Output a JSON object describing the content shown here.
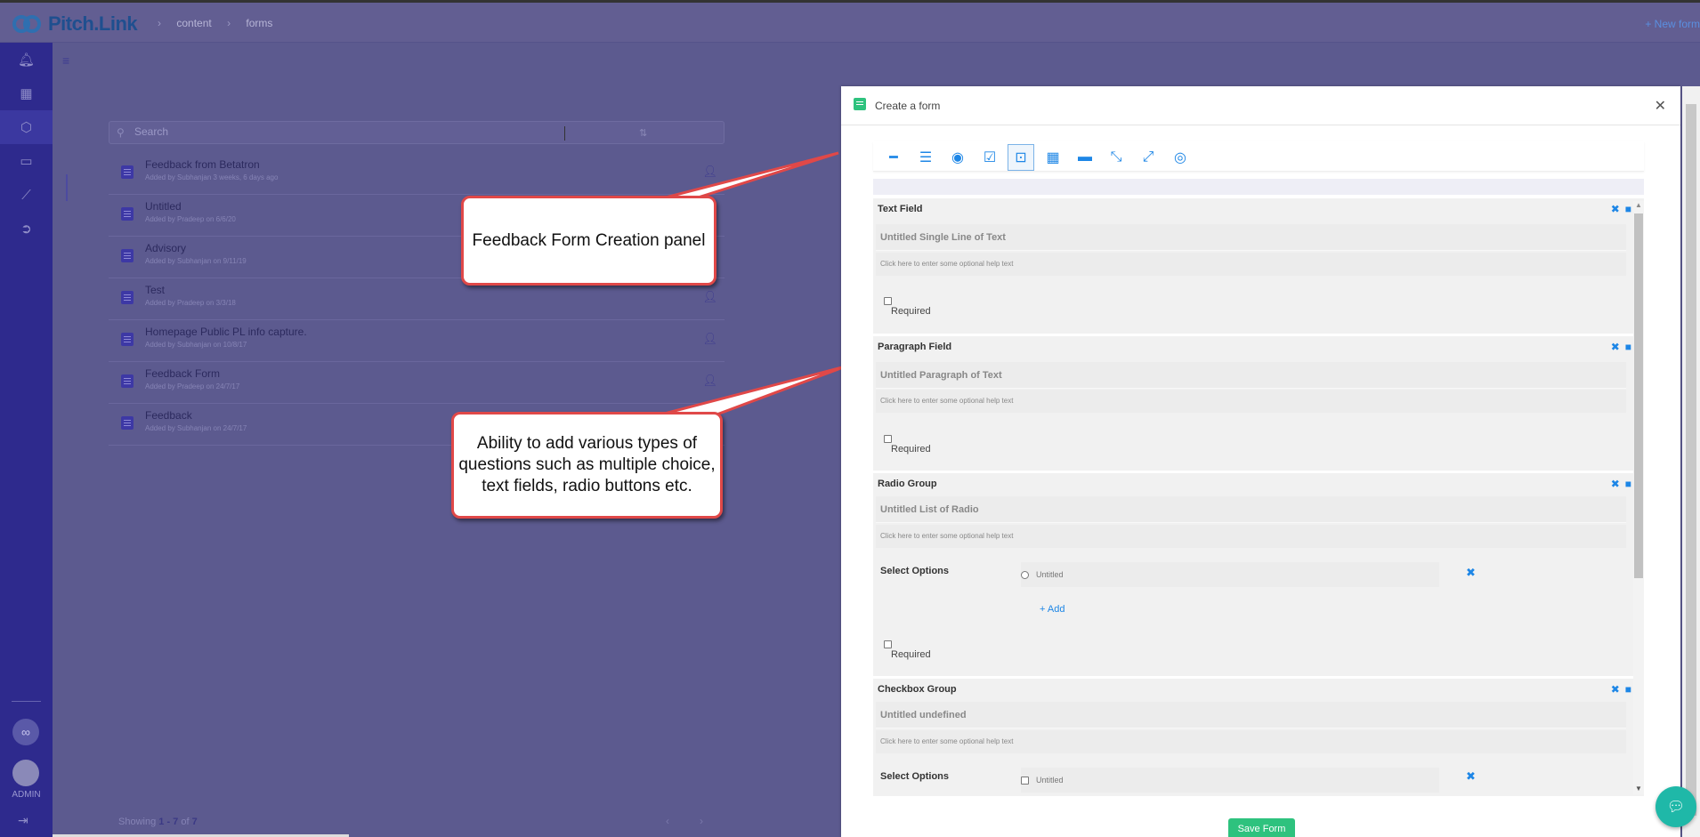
{
  "app": {
    "logo_text": "Pitch.Link",
    "breadcrumbs": [
      "content",
      "forms"
    ],
    "new_form_link": "+ New form"
  },
  "sidebar": {
    "icons": [
      "bell-icon",
      "dashboard-icon",
      "cube-icon",
      "presentation-icon",
      "chart-icon",
      "circle-arrow-icon"
    ],
    "active_index": 2,
    "user_label": "ADMIN"
  },
  "search": {
    "placeholder": "Search"
  },
  "forms_list": [
    {
      "title": "Feedback from Betatron",
      "subtitle": "Added by Subhanjan 3 weeks, 6 days ago",
      "assigned": true
    },
    {
      "title": "Untitled",
      "subtitle": "Added by Pradeep on 6/6/20",
      "assigned": false
    },
    {
      "title": "Advisory",
      "subtitle": "Added by Subhanjan on 9/11/19",
      "assigned": false
    },
    {
      "title": "Test",
      "subtitle": "Added by Pradeep on 3/3/18",
      "assigned": true
    },
    {
      "title": "Homepage Public PL info capture.",
      "subtitle": "Added by Subhanjan on 10/8/17",
      "assigned": true
    },
    {
      "title": "Feedback Form",
      "subtitle": "Added by Pradeep on 24/7/17",
      "assigned": true
    },
    {
      "title": "Feedback",
      "subtitle": "Added by Subhanjan on 24/7/17",
      "assigned": false
    }
  ],
  "pager": {
    "prefix": "Showing",
    "range": "1 - 7",
    "of": "of",
    "total": "7"
  },
  "callouts": {
    "panel": "Feedback Form Creation panel",
    "questions": "Ability to add various types of questions such as multiple choice, text fields, radio buttons etc."
  },
  "modal": {
    "title": "Create a form",
    "toolbar_icons": [
      "line-icon",
      "paragraph-icon",
      "radio-icon",
      "checkbox-icon",
      "dropdown-icon",
      "calendar-icon",
      "panel-icon",
      "compress-icon",
      "expand-icon",
      "preview-eye-icon"
    ],
    "toolbar_active_index": 4,
    "sections": [
      {
        "type": "Text Field",
        "label": "Untitled Single Line of Text",
        "help": "Click here to enter some optional help text",
        "required_label": "Required"
      },
      {
        "type": "Paragraph Field",
        "label": "Untitled Paragraph of Text",
        "help": "Click here to enter some optional help text",
        "required_label": "Required"
      },
      {
        "type": "Radio Group",
        "label": "Untitled List of Radio",
        "help": "Click here to enter some optional help text",
        "options_label": "Select Options",
        "option": "Untitled",
        "add_label": "Add",
        "required_label": "Required"
      },
      {
        "type": "Checkbox Group",
        "label": "Untitled undefined",
        "help": "Click here to enter some optional help text",
        "options_label": "Select Options",
        "option": "Untitled"
      }
    ],
    "save_label": "Save Form"
  },
  "colors": {
    "accent_blue": "#1d86e6",
    "save_green": "#2ec27e",
    "callout_border": "#e04848",
    "sidebar_bg": "#2e2a8d"
  }
}
